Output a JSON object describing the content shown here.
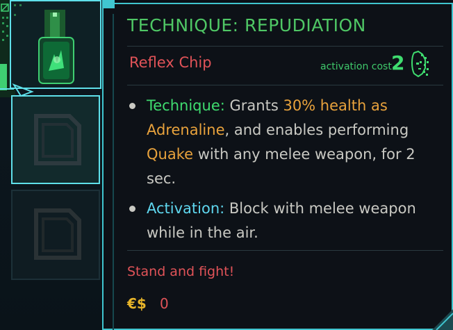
{
  "item": {
    "title": "TECHNIQUE: REPUDIATION",
    "type": "Reflex Chip",
    "activation_cost_label": "activation cost",
    "activation_cost_value": "2",
    "effects": [
      {
        "label": "Technique:",
        "parts": [
          {
            "text": " Grants ",
            "style": "plain"
          },
          {
            "text": "30% health as Adrenaline",
            "style": "orange"
          },
          {
            "text": ", and enables performing ",
            "style": "plain"
          },
          {
            "text": "Quake",
            "style": "orange"
          },
          {
            "text": " with any melee weapon, for 2 sec.",
            "style": "plain"
          }
        ]
      },
      {
        "label": "Activation:",
        "parts": [
          {
            "text": " Block with melee weapon while in the air.",
            "style": "plain"
          }
        ]
      }
    ],
    "flavor_text": "Stand and fight!",
    "price_icon": "€$",
    "price_value": "0"
  },
  "colors": {
    "title": "#4fc765",
    "accent_frame": "#40c6d0",
    "type_red": "#e05358",
    "keyword_orange": "#e8a23c",
    "technique_green": "#3fdc6f",
    "activation_cyan": "#5fd7ef"
  },
  "icons": {
    "chip_item": "reflex-chip-icon",
    "empty_slot": "empty-slot-icon",
    "activation": "face-circuit-icon",
    "currency": "eurodollar-icon"
  }
}
